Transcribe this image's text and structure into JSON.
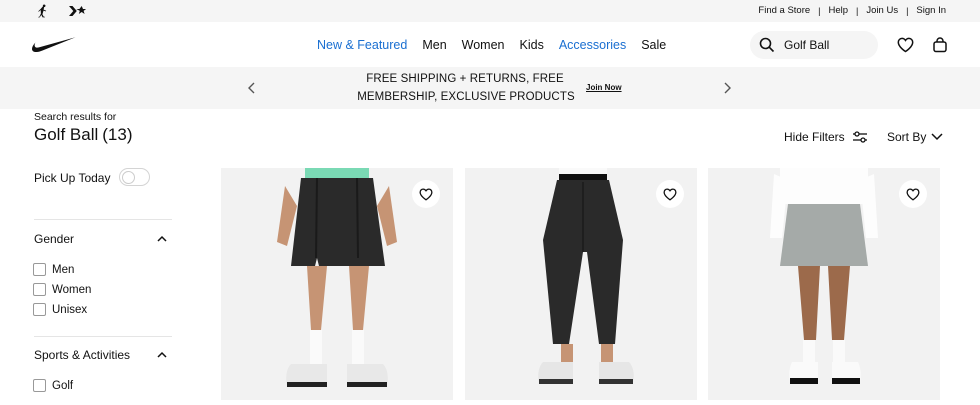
{
  "utility_bar": {
    "links": [
      {
        "label": "Find a Store"
      },
      {
        "label": "Help"
      },
      {
        "label": "Join Us"
      },
      {
        "label": "Sign In"
      }
    ],
    "brand_icons": [
      "jordan-jumpman-icon",
      "converse-star-chevron-icon"
    ]
  },
  "header": {
    "logo": "nike-swoosh-logo",
    "nav": [
      {
        "label": "New & Featured",
        "color": "#1a6fd1"
      },
      {
        "label": "Men"
      },
      {
        "label": "Women"
      },
      {
        "label": "Kids"
      },
      {
        "label": "Accessories",
        "color": "#1a6fd1"
      },
      {
        "label": "Sale"
      }
    ],
    "search": {
      "value": "Golf Ball",
      "icon": "search-icon"
    },
    "icons": [
      "heart-icon",
      "bag-icon"
    ]
  },
  "promo": {
    "line1": "FREE SHIPPING + RETURNS, FREE",
    "line2": "MEMBERSHIP, EXCLUSIVE PRODUCTS",
    "cta": "Join Now"
  },
  "results": {
    "label": "Search results for",
    "query": "Golf Ball",
    "count": "(13)"
  },
  "toolbar": {
    "hide_filters": "Hide Filters",
    "sort_by": "Sort By"
  },
  "filters": {
    "pickup_label": "Pick Up Today",
    "pickup_enabled": false,
    "sections": [
      {
        "title": "Gender",
        "options": [
          "Men",
          "Women",
          "Unisex"
        ]
      },
      {
        "title": "Sports & Activities",
        "options": [
          "Golf"
        ]
      }
    ]
  },
  "products": [
    {
      "image": "black-golf-shorts-image"
    },
    {
      "image": "black-golf-pants-image"
    },
    {
      "image": "grey-golf-skirt-image"
    }
  ]
}
